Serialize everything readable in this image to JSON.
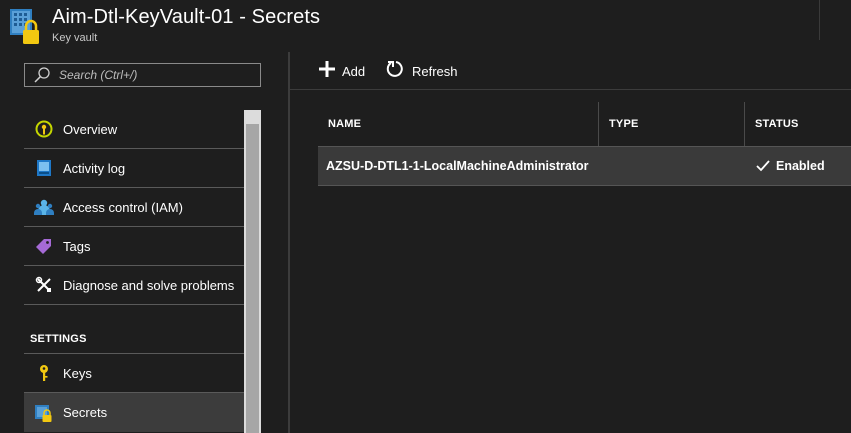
{
  "header": {
    "title": "Aim-Dtl-KeyVault-01 - Secrets",
    "subtitle": "Key vault",
    "icon": "key-vault-icon"
  },
  "search": {
    "placeholder": "Search (Ctrl+/)"
  },
  "sidebar": {
    "items": [
      {
        "label": "Overview",
        "icon": "overview-icon"
      },
      {
        "label": "Activity log",
        "icon": "activity-log-icon"
      },
      {
        "label": "Access control (IAM)",
        "icon": "access-control-icon"
      },
      {
        "label": "Tags",
        "icon": "tag-icon"
      },
      {
        "label": "Diagnose and solve problems",
        "icon": "wrench-icon"
      }
    ],
    "settings_header": "SETTINGS",
    "settings_items": [
      {
        "label": "Keys",
        "icon": "key-icon"
      },
      {
        "label": "Secrets",
        "icon": "secret-icon",
        "selected": true
      }
    ]
  },
  "toolbar": {
    "add_label": "Add",
    "refresh_label": "Refresh"
  },
  "table": {
    "columns": [
      "NAME",
      "TYPE",
      "STATUS"
    ],
    "rows": [
      {
        "name": "AZSU-D-DTL1-1-LocalMachineAdministrator",
        "type": "",
        "status": "Enabled"
      }
    ]
  },
  "colors": {
    "background": "#1e1e1e",
    "selected": "#3c3c3c",
    "accent_blue": "#0078d4",
    "accent_yellow": "#f2c811"
  }
}
